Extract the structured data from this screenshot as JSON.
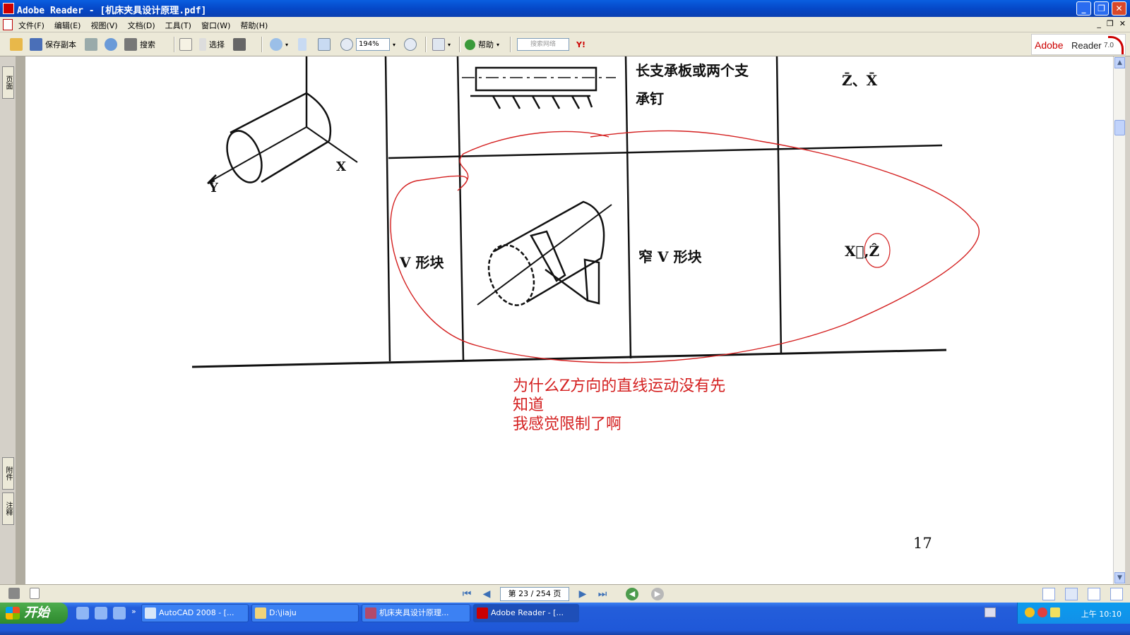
{
  "window": {
    "title": "Adobe Reader - [机床夹具设计原理.pdf]",
    "min": "_",
    "max": "❐",
    "close": "✕"
  },
  "menu": {
    "items": [
      "文件(F)",
      "编辑(E)",
      "视图(V)",
      "文档(D)",
      "工具(T)",
      "窗口(W)",
      "帮助(H)"
    ],
    "mdi_min": "_",
    "mdi_restore": "❐",
    "mdi_close": "✕"
  },
  "toolbar": {
    "save_copy": "保存副本",
    "search": "搜索",
    "select": "选择",
    "zoom_value": "194%",
    "help": "帮助",
    "search_web_placeholder": "搜索网络",
    "yahoo": "Y!",
    "brand_adobe": "Adobe",
    "brand_reader": "Reader",
    "brand_version": "7.0"
  },
  "side_tabs": {
    "pages": "页面",
    "attachments": "附件",
    "comments": "注释"
  },
  "document": {
    "axis_y": "Y",
    "axis_x": "X",
    "cell_long_support": "长支承板或两个支",
    "cell_long_support_2": "承钉",
    "cell_dof_top": "Z̄、X̄",
    "cell_v_block": "V 形块",
    "cell_narrow_v_block": "窄 V 形块",
    "cell_dof_bottom": "X⃗,Ẑ",
    "page_number": "17",
    "annotation_lines": [
      "为什么Z方向的直线运动没有先",
      "知道",
      "我感觉限制了啊"
    ],
    "annotation_color": "#d42020"
  },
  "statusbar": {
    "page_display": "第 23 / 254 页",
    "first": "⏮",
    "prev": "◀",
    "next": "▶",
    "last": "⏭",
    "back": "◀",
    "forward": "▶"
  },
  "taskbar": {
    "start": "开始",
    "tasks": [
      "AutoCAD 2008 - [...",
      "D:\\jiaju",
      "机床夹具设计原理...",
      "Adobe Reader - [..."
    ],
    "clock": "上午 10:10"
  }
}
